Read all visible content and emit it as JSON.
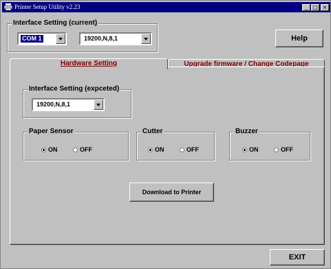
{
  "window": {
    "title": "Printer Setup Utility v2.23"
  },
  "interface_current": {
    "label": "Interface Setting (current)",
    "port": "COM 1",
    "baud": "19200,N,8,1"
  },
  "help_label": "Help",
  "tabs": [
    {
      "label": "Hardware Setting",
      "active": true
    },
    {
      "label": "Upgrade firmware / Change Codepage",
      "active": false
    }
  ],
  "interface_expected": {
    "label": "Interface Setting (expceted)",
    "baud": "19200,N,8,1"
  },
  "paper_sensor": {
    "label": "Paper Sensor",
    "on": "ON",
    "off": "OFF",
    "selected": "ON"
  },
  "cutter": {
    "label": "Cutter",
    "on": "ON",
    "off": "OFF",
    "selected": "ON"
  },
  "buzzer": {
    "label": "Buzzer",
    "on": "ON",
    "off": "OFF",
    "selected": "ON"
  },
  "download_label": "Download to Printer",
  "exit_label": "EXIT"
}
